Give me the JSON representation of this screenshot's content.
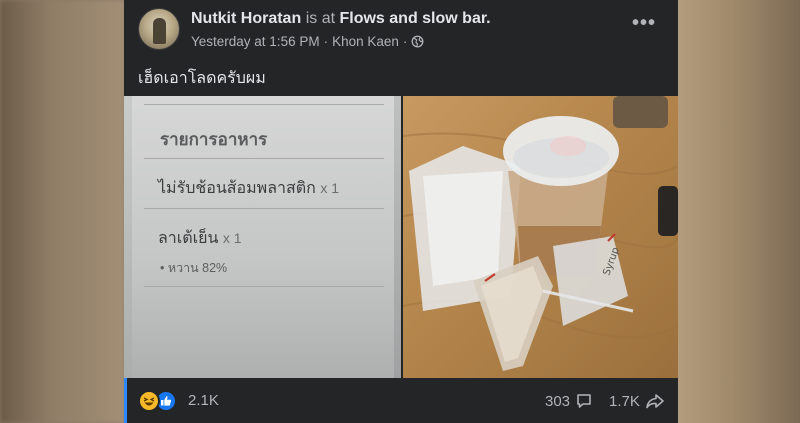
{
  "post": {
    "author": "Nutkit Horatan",
    "connector": "is at",
    "place": "Flows and slow bar.",
    "timestamp": "Yesterday at 1:56 PM",
    "separator": "·",
    "location": "Khon Kaen",
    "more_label": "•••",
    "caption": "เฮ็ดเอาโลดครับผม",
    "privacy_icon": "globe-icon"
  },
  "photos": {
    "left": {
      "heading": "รายการอาหาร",
      "items": [
        {
          "name": "ไม่รับช้อนส้อมพลาสติก",
          "qty": "x 1"
        },
        {
          "name": "ลาเต้เย็น",
          "qty": "x 1"
        }
      ],
      "option": "• หวาน 82%"
    },
    "right": {
      "bag_label": "Syrup"
    }
  },
  "engagement": {
    "reaction_icons": [
      "haha-icon",
      "like-icon"
    ],
    "reaction_count": "2.1K",
    "comment_count": "303",
    "share_count": "1.7K"
  },
  "colors": {
    "card_bg": "#242526",
    "primary_text": "#e4e6eb",
    "secondary_text": "#b0b3b8",
    "like_blue": "#1877f2",
    "haha_yellow": "#f7b928"
  }
}
